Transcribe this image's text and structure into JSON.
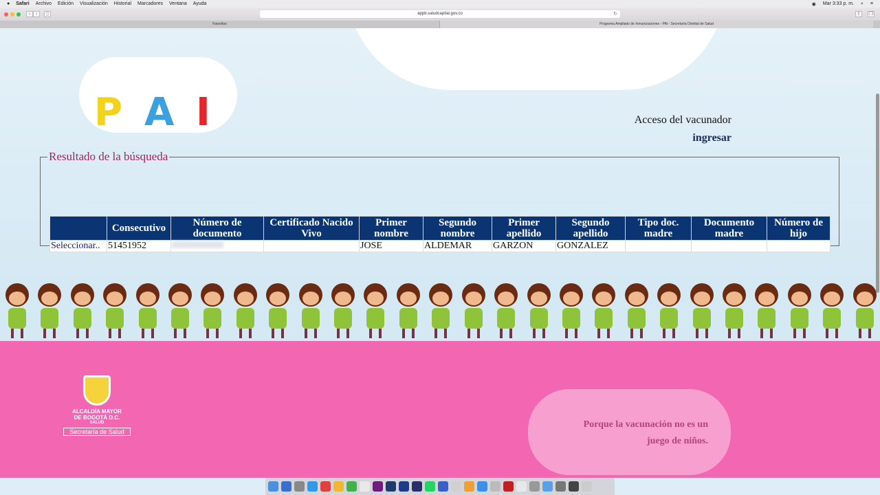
{
  "menubar": {
    "apple": "",
    "items": [
      "Safari",
      "Archivo",
      "Edición",
      "Visualización",
      "Historial",
      "Marcadores",
      "Ventana",
      "Ayuda"
    ],
    "clock": "Mar 3:33 p. m."
  },
  "browser": {
    "url": "appb.saludcapital.gov.co",
    "tabs": [
      "Favoritos",
      "Programa Ampliado de Inmunizaciones - PAI - Secretaría Distrital de Salud"
    ]
  },
  "header": {
    "logo_letters": [
      "P",
      "A",
      "I"
    ],
    "access_label": "Acceso del vacunador",
    "login_link": "ingresar"
  },
  "results": {
    "title": "Resultado de la búsqueda",
    "columns": [
      "",
      "Consecutivo",
      "Número de documento",
      "Certificado Nacido Vivo",
      "Primer nombre",
      "Segundo nombre",
      "Primer apellido",
      "Segundo apellido",
      "Tipo doc. madre",
      "Documento madre",
      "Número de hijo"
    ],
    "rows": [
      {
        "select": "Seleccionar..",
        "consecutivo": "51451952",
        "documento": "",
        "certificado": "",
        "primer_nombre": "JOSE",
        "segundo_nombre": "ALDEMAR",
        "primer_apellido": "GARZON",
        "segundo_apellido": "GONZALEZ",
        "tipo_doc_madre": "",
        "documento_madre": "",
        "numero_hijo": ""
      }
    ]
  },
  "footer": {
    "logo_lines": [
      "ALCALDÍA MAYOR",
      "DE BOGOTÁ D.C.",
      "SALUD"
    ],
    "logo_secretaria": "Secretaría de Salud",
    "slogan_1": "Porque la vacunación no es un",
    "slogan_2": "juego de niños."
  },
  "colors": {
    "header_blue": "#0a3572",
    "legend_magenta": "#a3245c",
    "footer_pink": "#f266b2"
  }
}
